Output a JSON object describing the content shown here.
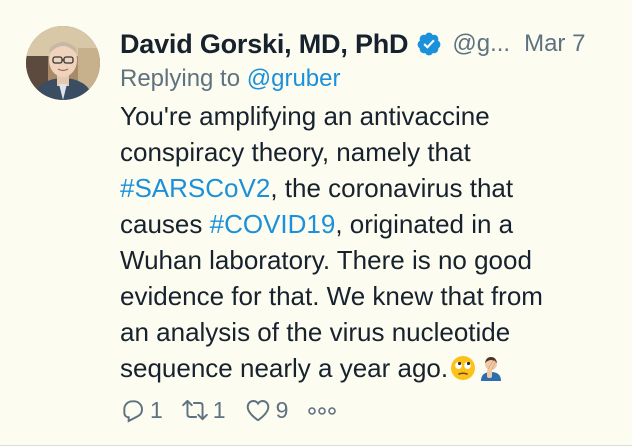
{
  "author": {
    "name": "David Gorski, MD, PhD",
    "handle": "@g...",
    "date": "Mar 7"
  },
  "reply": {
    "prefix": "Replying to",
    "mention": "@gruber"
  },
  "text": {
    "l1": "You're amplifying an antivaccine",
    "l2": "conspiracy theory, namely that",
    "l3_tag": "#SARSCoV2",
    "l3_rest": ", the coronavirus that",
    "l4_pre": "causes ",
    "l4_tag": "#COVID19",
    "l4_rest": ", originated in a",
    "l5": "Wuhan laboratory. There is no good",
    "l6": "evidence for that. We knew that from",
    "l7": "an analysis of the virus nucleotide",
    "l8": "sequence nearly a year ago."
  },
  "actions": {
    "replies": "1",
    "retweets": "1",
    "likes": "9"
  },
  "colors": {
    "background": "#fcfcf0",
    "link": "#1a91da",
    "secondary": "#5f7280",
    "text": "#17222e"
  },
  "icons": [
    "verified-badge-icon",
    "face-with-rolling-eyes-emoji",
    "person-facepalming-emoji",
    "reply-icon",
    "retweet-icon",
    "like-icon",
    "more-icon"
  ]
}
